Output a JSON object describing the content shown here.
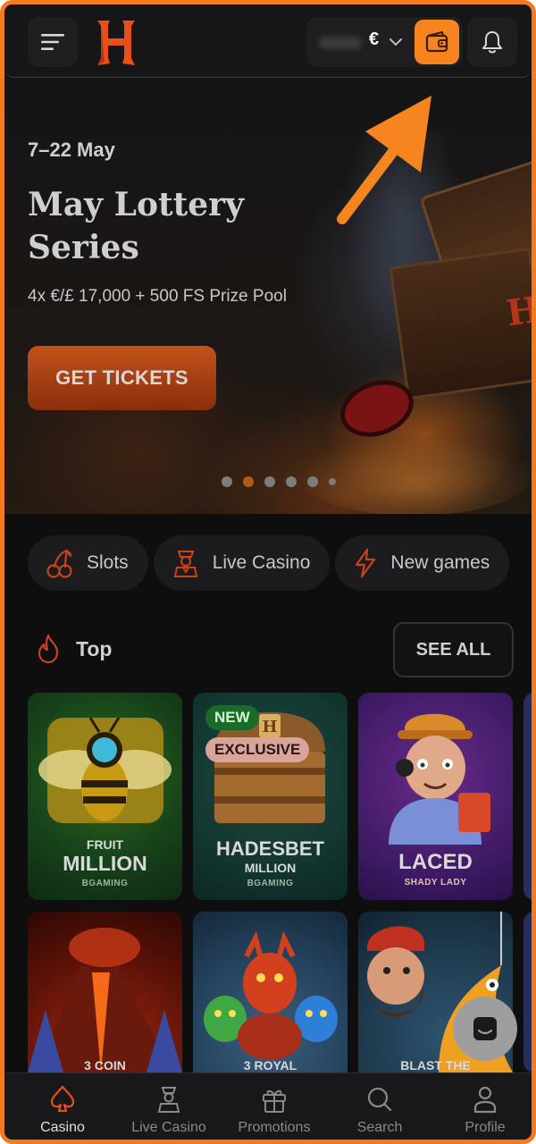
{
  "header": {
    "currency": "€",
    "icons": [
      "menu-icon",
      "hadesbet-logo",
      "chevron-down-icon",
      "wallet-icon",
      "bell-icon"
    ]
  },
  "hero": {
    "date": "7–22 May",
    "title": "May Lottery Series",
    "subtitle": "4x €/£ 17,000 + 500 FS Prize Pool",
    "cta": "GET TICKETS",
    "logo_letter": "H",
    "slides_total": 6,
    "active_slide": 2
  },
  "categories": [
    {
      "label": "Slots",
      "icon": "cherries-icon"
    },
    {
      "label": "Live Casino",
      "icon": "dealer-icon"
    },
    {
      "label": "New games",
      "icon": "lightning-icon"
    }
  ],
  "top_section": {
    "title": "Top",
    "see_all": "SEE ALL"
  },
  "games": [
    {
      "name_top": "FRUIT",
      "name": "MILLION",
      "provider": "BGAMING",
      "badges": []
    },
    {
      "name_top": "",
      "name": "HADESBET",
      "name_sub": "MILLION",
      "provider": "BGAMING",
      "badges": [
        "NEW",
        "EXCLUSIVE"
      ]
    },
    {
      "name_top": "",
      "name": "LACED",
      "provider": "SHADY LADY",
      "badges": []
    },
    {
      "name": "3 COIN"
    },
    {
      "name": "3 ROYAL"
    },
    {
      "name": "BLAST THE"
    }
  ],
  "bottom_nav": [
    {
      "label": "Casino",
      "icon": "spade-icon",
      "active": true
    },
    {
      "label": "Live Casino",
      "icon": "dealer-icon",
      "active": false
    },
    {
      "label": "Promotions",
      "icon": "gift-icon",
      "active": false
    },
    {
      "label": "Search",
      "icon": "search-icon",
      "active": false
    },
    {
      "label": "Profile",
      "icon": "user-icon",
      "active": false
    }
  ],
  "colors": {
    "accent": "#f7851f",
    "background": "#0e0e0f",
    "frame": "#f47a1f"
  }
}
